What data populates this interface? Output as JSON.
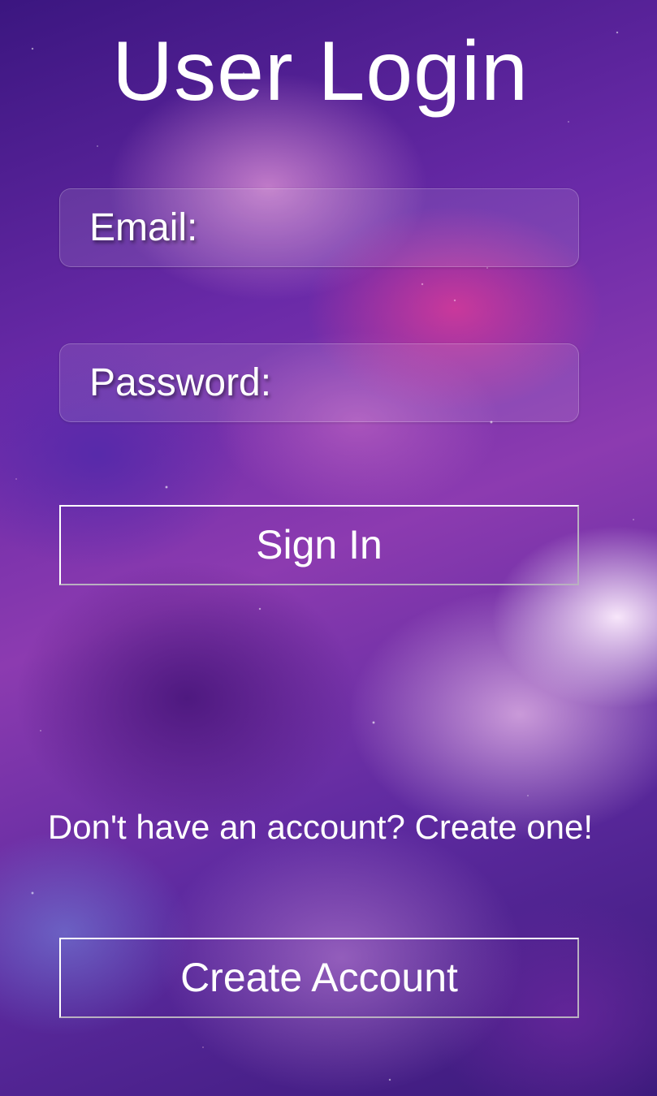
{
  "title": "User Login",
  "email": {
    "label": "Email:",
    "value": ""
  },
  "password": {
    "label": "Password:",
    "value": ""
  },
  "sign_in_label": "Sign In",
  "signup_prompt": "Don't have an account? Create one!",
  "create_account_label": "Create Account"
}
